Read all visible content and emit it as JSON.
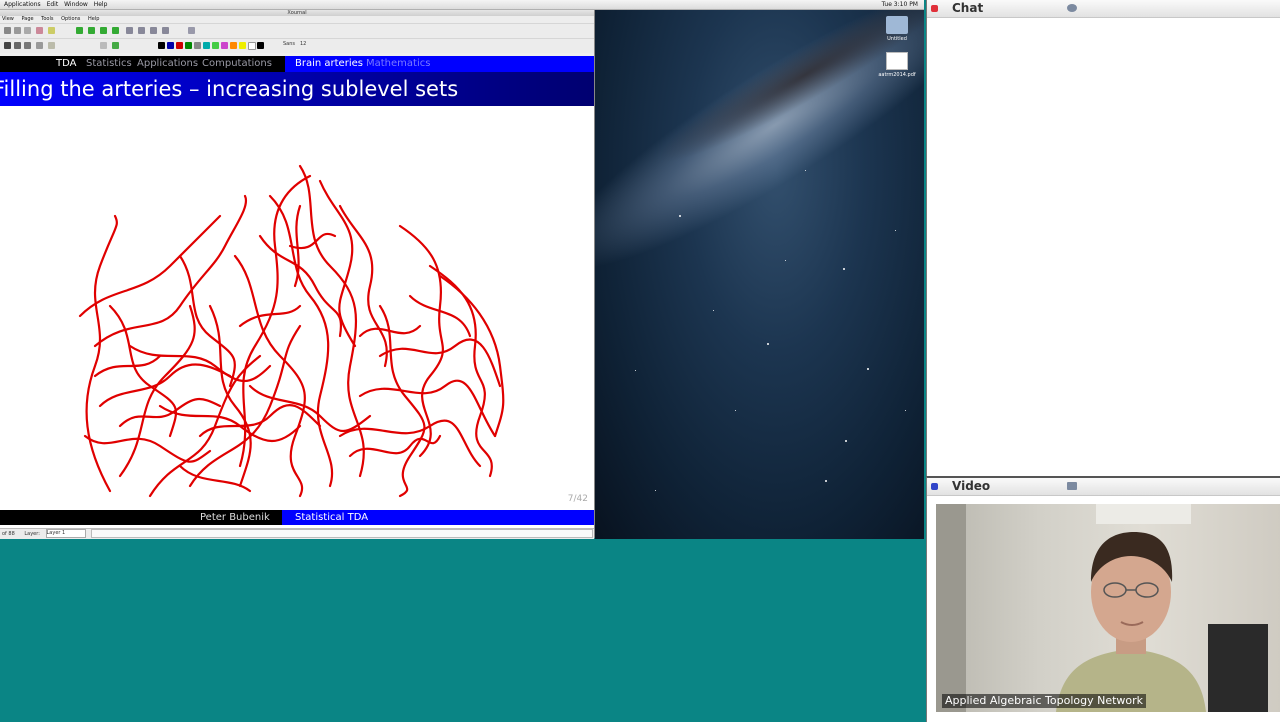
{
  "menubar": {
    "items": [
      "Applications",
      "Edit",
      "Window",
      "Help"
    ],
    "clock": "Tue 3:10 PM"
  },
  "xournal": {
    "title": "Xournal",
    "menu": [
      "View",
      "Page",
      "Tools",
      "Options",
      "Help"
    ],
    "font_button": "Sans",
    "font_size": "12",
    "status": {
      "page": "of 88",
      "layer_label": "Layer:",
      "layer_value": "Layer 1"
    }
  },
  "slide": {
    "nav_left": "TDA",
    "nav_items": [
      "Statistics",
      "Applications",
      "Computations"
    ],
    "nav_active": "Brain arteries",
    "nav_inactive": "Mathematics",
    "title": "Filling the arteries – increasing sublevel sets",
    "page_number": "7/42",
    "footer_author": "Peter Bubenik",
    "footer_talk": "Statistical TDA"
  },
  "desktop": {
    "icons": [
      "Untitled",
      "aatrm2014.pdf"
    ]
  },
  "chat": {
    "title": "Chat"
  },
  "video": {
    "title": "Video",
    "caption": "Applied Algebraic Topology Network"
  },
  "colors": {
    "beamer_blue": "#0000ff",
    "artery_red": "#e00000",
    "desktop_teal": "#0a8585"
  }
}
